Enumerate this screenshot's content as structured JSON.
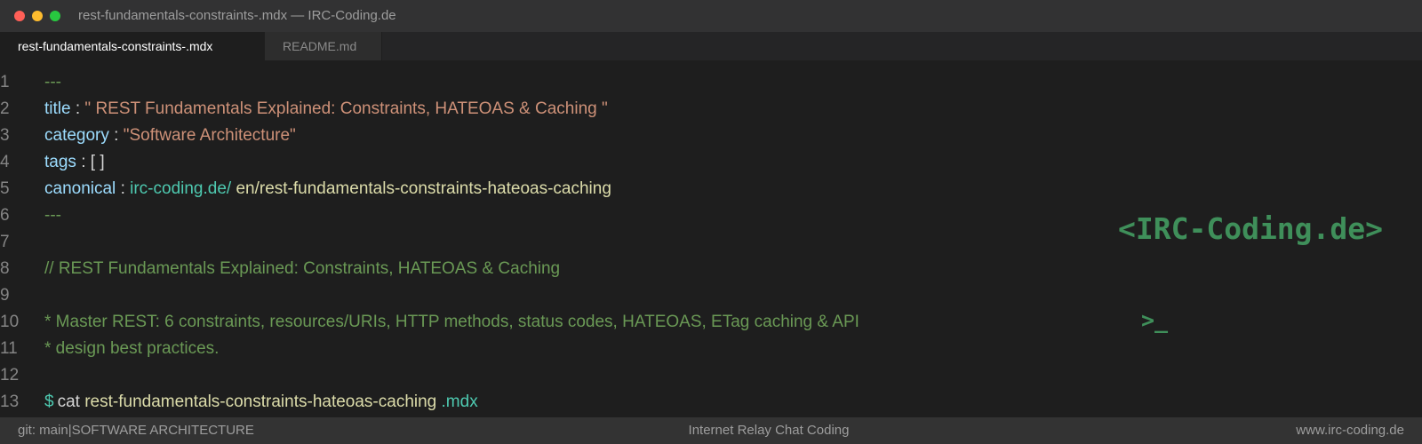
{
  "window": {
    "title": "rest-fundamentals-constraints-.mdx — IRC-Coding.de"
  },
  "tabs": [
    {
      "label": "rest-fundamentals-constraints-.mdx",
      "active": true
    },
    {
      "label": "README.md",
      "active": false
    }
  ],
  "editor": {
    "line_numbers": [
      "1",
      "2",
      "3",
      "4",
      "5",
      "6",
      "7",
      "8",
      "9",
      "10",
      "11",
      "12",
      "13"
    ],
    "lines": {
      "l1": {
        "dashes": "---"
      },
      "l2": {
        "key": "title",
        "sep": ":",
        "value": "\" REST Fundamentals Explained: Constraints, HATEOAS & Caching \""
      },
      "l3": {
        "key": "category",
        "sep": ":",
        "value": "\"Software Architecture\""
      },
      "l4": {
        "key": "tags",
        "sep": ":",
        "value": "[ ]"
      },
      "l5": {
        "key": "canonical",
        "sep": ":",
        "domain": "irc-coding.de/",
        "path": "en/rest-fundamentals-constraints-hateoas-caching"
      },
      "l6": {
        "dashes": "---"
      },
      "l8": {
        "comment": "// REST Fundamentals Explained: Constraints, HATEOAS & Caching"
      },
      "l10": {
        "comment": "* Master REST: 6 constraints, resources/URIs, HTTP methods, status codes, HATEOAS, ETag caching & API"
      },
      "l11": {
        "comment": "* design best practices."
      },
      "l13": {
        "prompt": "$",
        "command": "cat",
        "filename": "rest-fundamentals-constraints-hateoas-caching",
        "ext": ".mdx"
      }
    }
  },
  "logo": {
    "text": "<IRC-Coding.de>",
    "prompt": ">_"
  },
  "statusbar": {
    "branch": "git: main",
    "category": "SOFTWARE ARCHITECTURE",
    "center": "Internet Relay Chat Coding",
    "right": "www.irc-coding.de"
  },
  "colors": {
    "background": "#1e1e1e",
    "key": "#9cdcfe",
    "string": "#ce9178",
    "comment": "#6a9955",
    "teal": "#4ec9b0",
    "logo": "#3f8f5a"
  }
}
